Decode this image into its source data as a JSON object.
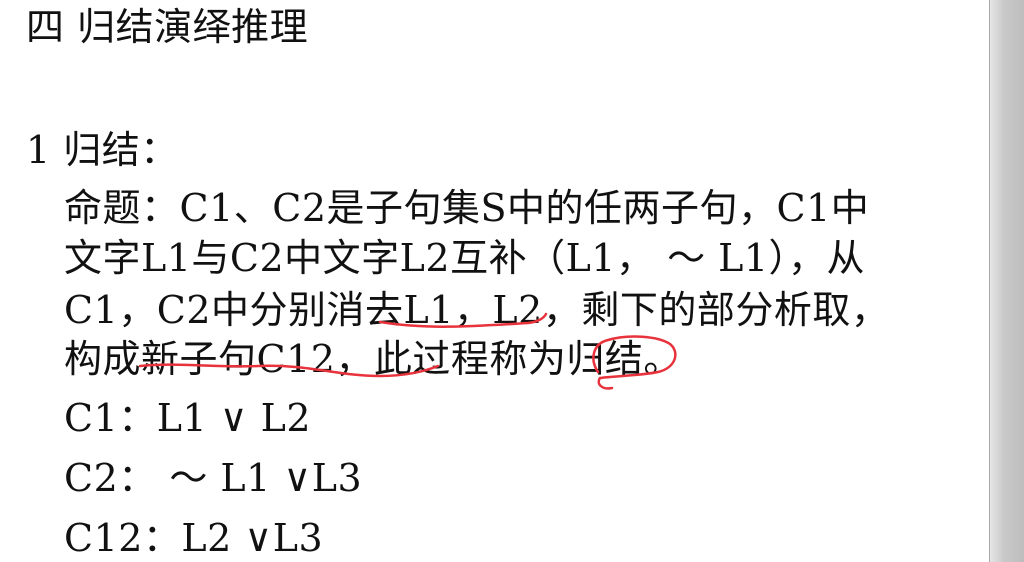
{
  "title": "四 归结演绎推理",
  "section_heading": "1 归结：",
  "definition_lines": [
    "命题：C1、C2是子句集S中的任两子句，C1中",
    "文字L1与C2中文字L2互补（L1， ～ L1），从",
    "C1，C2中分别消去L1，L2，剩下的部分析取，",
    "构成新子句C12，此过程称为归结。"
  ],
  "formulas": [
    "C1：L1 ∨ L2",
    "C2： ～ L1 ∨L3",
    "C12：L2 ∨L3"
  ],
  "annotation_color": "#e8323c"
}
